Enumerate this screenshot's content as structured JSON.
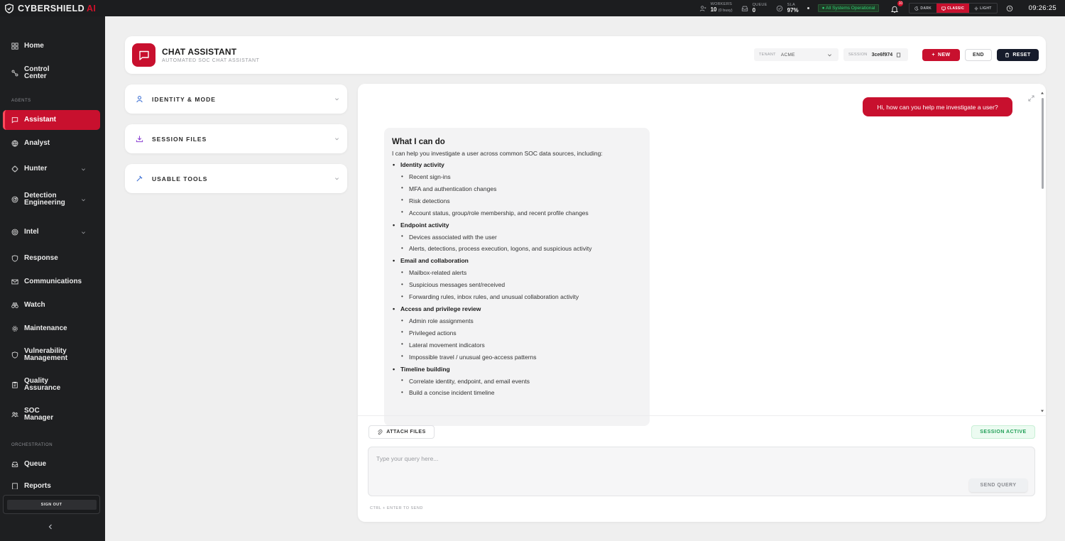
{
  "brand": {
    "name": "CYBERSHIELD",
    "suffix": "AI"
  },
  "topbar": {
    "workers": {
      "label": "WORKERS",
      "value": "10",
      "note": "(0 busy)"
    },
    "queue": {
      "label": "QUEUE",
      "value": "0"
    },
    "sla": {
      "label": "SLA",
      "value": "97%"
    },
    "status": "● All Systems Operational",
    "notifications_count": "10",
    "modes": [
      "DARK",
      "CLASSIC",
      "LIGHT"
    ],
    "active_mode": "CLASSIC",
    "time": "09:26:25"
  },
  "sidebar": {
    "items": [
      {
        "label": "Home",
        "icon": "grid-icon"
      },
      {
        "label": "Control Center",
        "icon": "nodes-icon"
      },
      {
        "label": "Assistant",
        "icon": "chat-icon",
        "active": true
      },
      {
        "label": "Analyst",
        "icon": "globe-icon"
      },
      {
        "label": "Hunter",
        "icon": "crosshair-icon",
        "has_children": true
      },
      {
        "label": "Detection Engineering",
        "icon": "radar-icon",
        "has_children": true
      },
      {
        "label": "Intel",
        "icon": "target-icon",
        "has_children": true
      },
      {
        "label": "Response",
        "icon": "shield-icon"
      },
      {
        "label": "Communications",
        "icon": "mail-icon"
      },
      {
        "label": "Watch",
        "icon": "binoculars-icon"
      },
      {
        "label": "Maintenance",
        "icon": "gear-icon"
      },
      {
        "label": "Vulnerability Management",
        "icon": "shield-icon"
      },
      {
        "label": "Quality Assurance",
        "icon": "clipboard-icon"
      },
      {
        "label": "SOC Manager",
        "icon": "team-icon"
      },
      {
        "label": "Queue",
        "icon": "inbox-icon"
      },
      {
        "label": "Reports",
        "icon": "report-icon"
      }
    ],
    "sections": {
      "agents": "AGENTS",
      "orchestration": "ORCHESTRATION"
    },
    "sign_out": "SIGN OUT"
  },
  "header": {
    "title": "CHAT ASSISTANT",
    "subtitle": "AUTOMATED SOC CHAT ASSISTANT",
    "tenant_label": "TENANT",
    "tenant_value": "ACME",
    "session_label": "SESSION",
    "session_value": "3ce6f974",
    "new_label": "NEW",
    "end_label": "END",
    "reset_label": "RESET"
  },
  "panels": [
    {
      "label": "IDENTITY & MODE",
      "icon": "user-icon",
      "color": "#3b6fd4"
    },
    {
      "label": "SESSION FILES",
      "icon": "download-icon",
      "color": "#8a3fd1"
    },
    {
      "label": "USABLE TOOLS",
      "icon": "wrench-icon",
      "color": "#3b6fd4"
    }
  ],
  "chat": {
    "user_message": "Hi, how can you help me investigate a user?",
    "assistant": {
      "title": "What I can do",
      "intro": "I can help you investigate a user across common SOC data sources, including:",
      "sections": [
        {
          "heading": "Identity activity",
          "items": [
            "Recent sign-ins",
            "MFA and authentication changes",
            "Risk detections",
            "Account status, group/role membership, and recent profile changes"
          ]
        },
        {
          "heading": "Endpoint activity",
          "items": [
            "Devices associated with the user",
            "Alerts, detections, process execution, logons, and suspicious activity"
          ]
        },
        {
          "heading": "Email and collaboration",
          "items": [
            "Mailbox-related alerts",
            "Suspicious messages sent/received",
            "Forwarding rules, inbox rules, and unusual collaboration activity"
          ]
        },
        {
          "heading": "Access and privilege review",
          "items": [
            "Admin role assignments",
            "Privileged actions",
            "Lateral movement indicators",
            "Impossible travel / unusual geo-access patterns"
          ]
        },
        {
          "heading": "Timeline building",
          "items": [
            "Correlate identity, endpoint, and email events",
            "Build a concise incident timeline"
          ]
        }
      ]
    },
    "attach_label": "ATTACH FILES",
    "session_status": "SESSION ACTIVE",
    "input_placeholder": "Type your query here...",
    "send_label": "SEND QUERY",
    "hint": "CTRL + ENTER TO SEND"
  },
  "colors": {
    "accent": "#c8102e",
    "sidebar_bg": "#1e1f21",
    "status_green": "#1e9e55"
  }
}
